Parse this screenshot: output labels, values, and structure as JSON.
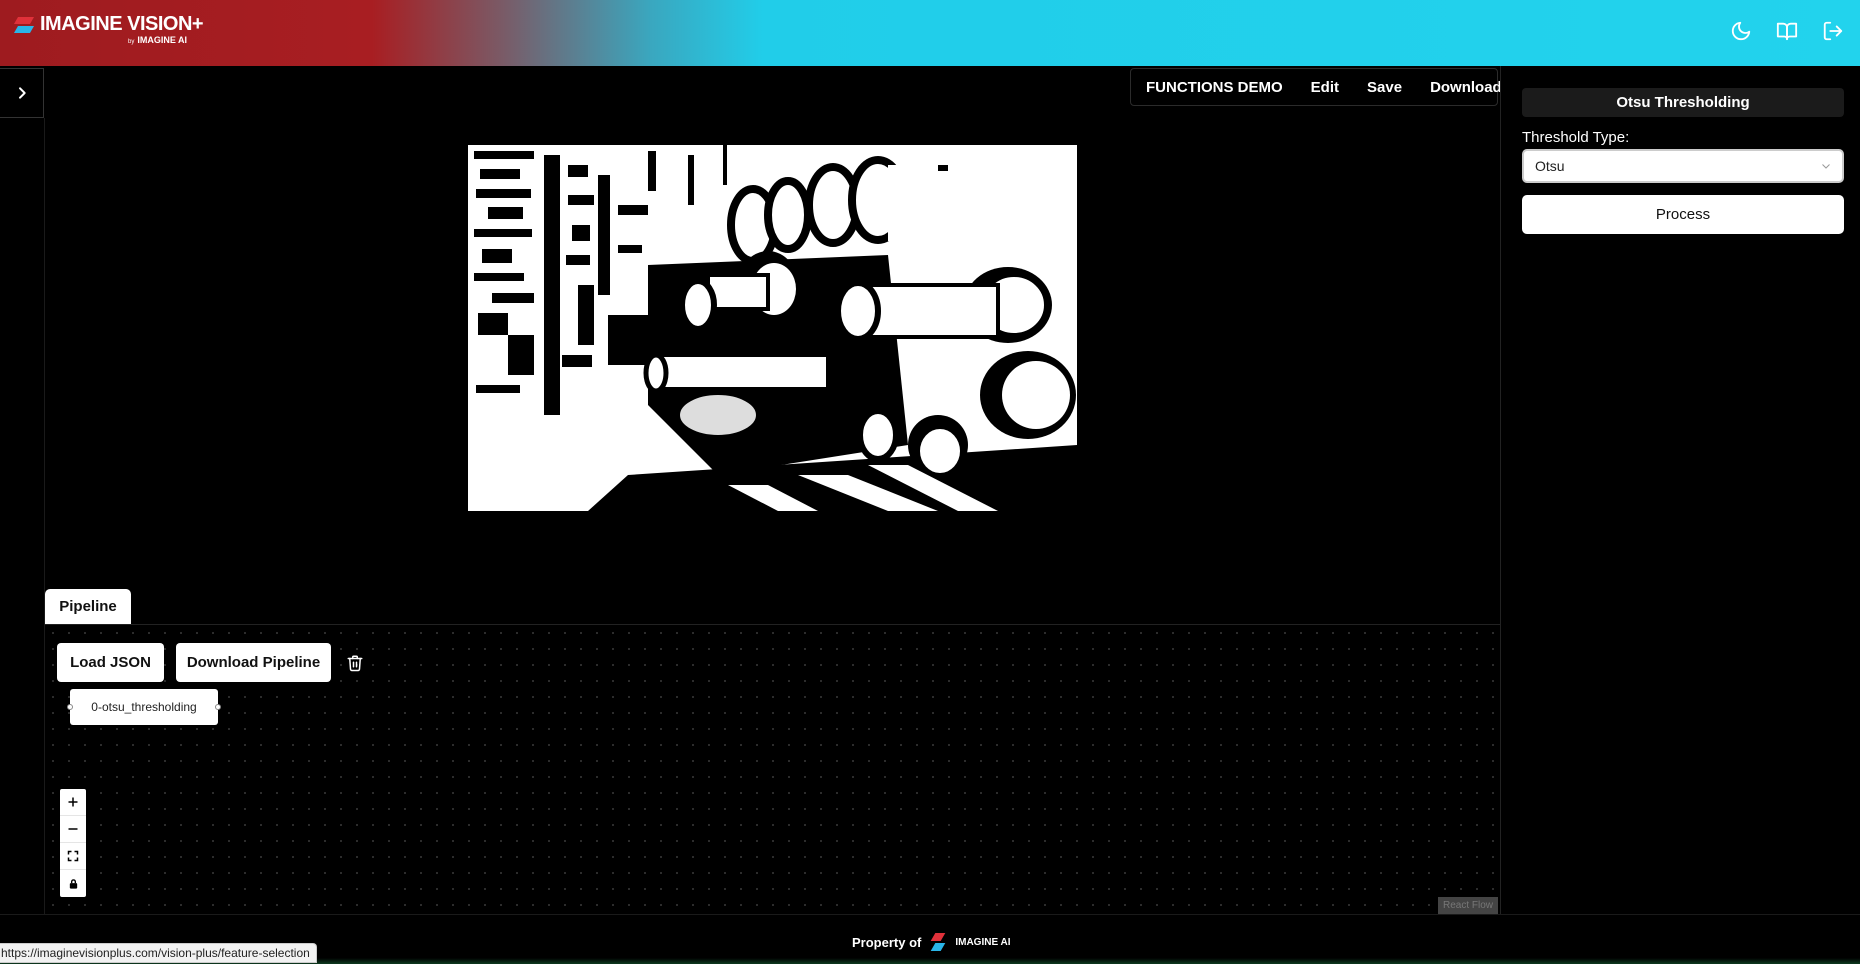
{
  "header": {
    "brand_title": "IMAGINE VISION+",
    "brand_by": "by",
    "brand_sub": "IMAGINE AI",
    "icons": [
      "moon-icon",
      "book-icon",
      "logout-icon"
    ]
  },
  "toolbar": {
    "items": [
      "FUNCTIONS DEMO",
      "Edit",
      "Save",
      "Download"
    ]
  },
  "right_panel": {
    "title": "Otsu Thresholding",
    "threshold_label": "Threshold Type:",
    "threshold_value": "Otsu",
    "process_label": "Process"
  },
  "pipeline": {
    "tab_label": "Pipeline",
    "load_json_label": "Load JSON",
    "download_pipeline_label": "Download Pipeline",
    "node_label": "0-otsu_thresholding",
    "attribution": "React Flow"
  },
  "footer": {
    "property_of": "Property of",
    "brand": "IMAGINE AI"
  },
  "status_bar": {
    "url": "https://imaginevisionplus.com/vision-plus/feature-selection"
  },
  "colors": {
    "header_red": "#a81e22",
    "header_cyan": "#22d3ed",
    "background": "#000000"
  }
}
